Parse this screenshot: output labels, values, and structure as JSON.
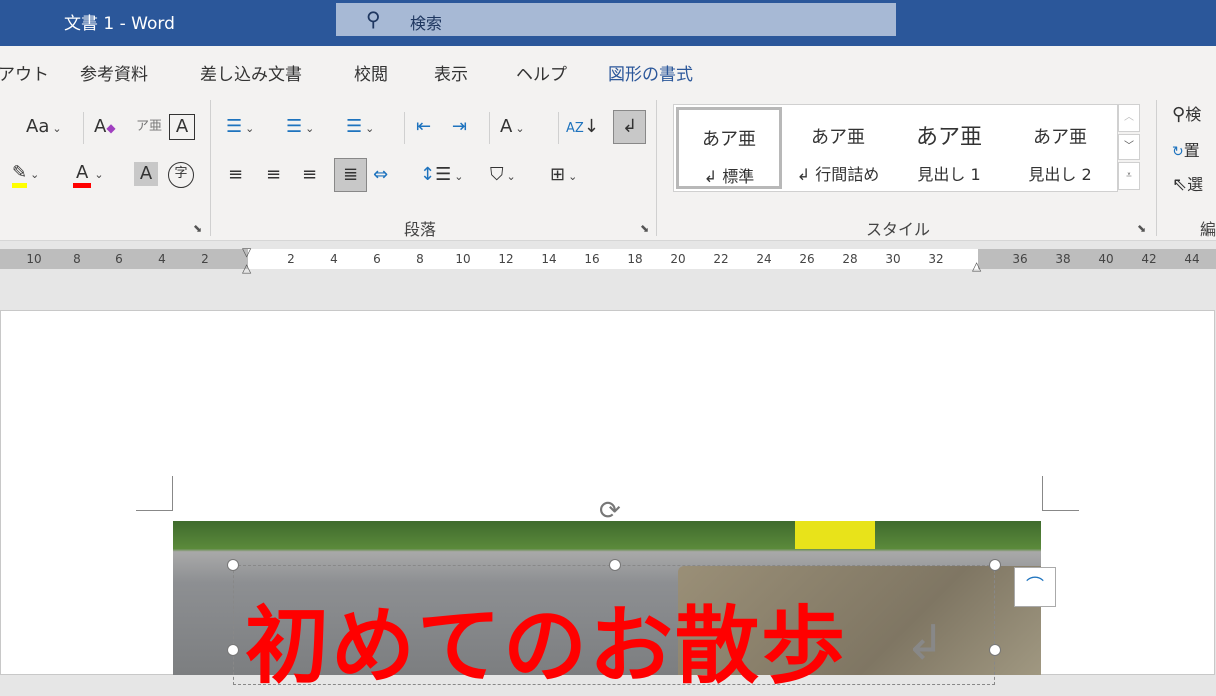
{
  "window": {
    "title": "文書 1  -  Word",
    "search_placeholder": "検索"
  },
  "tabs": [
    {
      "label": "アウト"
    },
    {
      "label": "参考資料"
    },
    {
      "label": "差し込み文書"
    },
    {
      "label": "校閲"
    },
    {
      "label": "表示"
    },
    {
      "label": "ヘルプ"
    },
    {
      "label": "図形の書式",
      "active": true
    }
  ],
  "ribbon": {
    "font": {
      "change_case": "Aa",
      "font_color": "#ff0000",
      "highlight_color": "#ffff00"
    },
    "paragraph": {
      "group_label": "段落"
    },
    "styles": {
      "group_label": "スタイル",
      "items": [
        {
          "preview": "あア亜",
          "label": "↲ 標準",
          "selected": true
        },
        {
          "preview": "あア亜",
          "label": "↲ 行間詰め"
        },
        {
          "preview": "あア亜",
          "label": "見出し 1"
        },
        {
          "preview": "あア亜",
          "label": "見出し 2"
        }
      ]
    },
    "editing": {
      "group_label": "編",
      "find": "検",
      "replace": "置",
      "select": "選"
    }
  },
  "ruler": {
    "left_numbers": [
      "10",
      "8",
      "6",
      "4",
      "2"
    ],
    "numbers": [
      "2",
      "4",
      "6",
      "8",
      "10",
      "12",
      "14",
      "16",
      "18",
      "20",
      "22",
      "24",
      "26",
      "28",
      "30",
      "32"
    ],
    "right_numbers": [
      "36",
      "38",
      "40",
      "42",
      "44"
    ]
  },
  "document": {
    "headline": "初めてのお散歩",
    "headline_color": "#ff0000"
  }
}
